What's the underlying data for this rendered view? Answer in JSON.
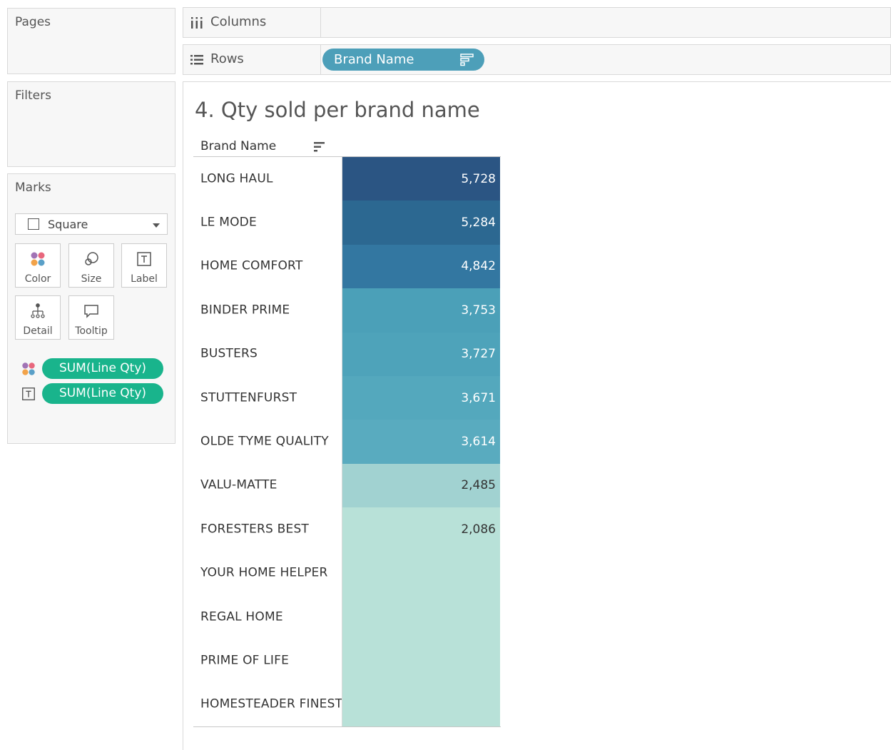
{
  "panels": {
    "pages_title": "Pages",
    "filters_title": "Filters",
    "marks_title": "Marks"
  },
  "marks": {
    "mark_type": "Square",
    "buttons": [
      "Color",
      "Size",
      "Label",
      "Detail",
      "Tooltip"
    ],
    "pills": [
      "SUM(Line Qty)",
      "SUM(Line Qty)"
    ]
  },
  "shelves": {
    "columns_label": "Columns",
    "rows_label": "Rows",
    "rows_pill": "Brand Name"
  },
  "colors": {
    "rows_pill": "#4d9fb9",
    "marks_pill": "#19b48c"
  },
  "view": {
    "title": "4. Qty sold per brand name",
    "column_header": "Brand Name"
  },
  "chart_data": {
    "type": "table",
    "title": "4. Qty sold per brand name",
    "row_header": "Brand Name",
    "measure": "SUM(Line Qty)",
    "rows": [
      {
        "brand": "LONG HAUL",
        "value": 5728,
        "label": "5,728",
        "color": "#2b5583"
      },
      {
        "brand": "LE MODE",
        "value": 5284,
        "label": "5,284",
        "color": "#2c6891"
      },
      {
        "brand": "HOME COMFORT",
        "value": 4842,
        "label": "4,842",
        "color": "#3377a1"
      },
      {
        "brand": "BINDER PRIME",
        "value": 3753,
        "label": "3,753",
        "color": "#4ba0b8"
      },
      {
        "brand": "BUSTERS",
        "value": 3727,
        "label": "3,727",
        "color": "#4ea3ba"
      },
      {
        "brand": "STUTTENFURST",
        "value": 3671,
        "label": "3,671",
        "color": "#54a8bd"
      },
      {
        "brand": "OLDE TYME QUALITY",
        "value": 3614,
        "label": "3,614",
        "color": "#59abbf"
      },
      {
        "brand": "VALU-MATTE",
        "value": 2485,
        "label": "2,485",
        "color": "#a1d2d1"
      },
      {
        "brand": "FORESTERS BEST",
        "value": 2086,
        "label": "2,086",
        "color": "#b8e1d8"
      },
      {
        "brand": "YOUR HOME HELPER",
        "value": null,
        "label": "",
        "color": "#b8e1d8"
      },
      {
        "brand": "REGAL HOME",
        "value": null,
        "label": "",
        "color": "#b8e1d8"
      },
      {
        "brand": "PRIME OF LIFE",
        "value": null,
        "label": "",
        "color": "#b8e1d8"
      },
      {
        "brand": "HOMESTEADER FINEST",
        "value": null,
        "label": "",
        "color": "#b8e1d8"
      }
    ]
  }
}
